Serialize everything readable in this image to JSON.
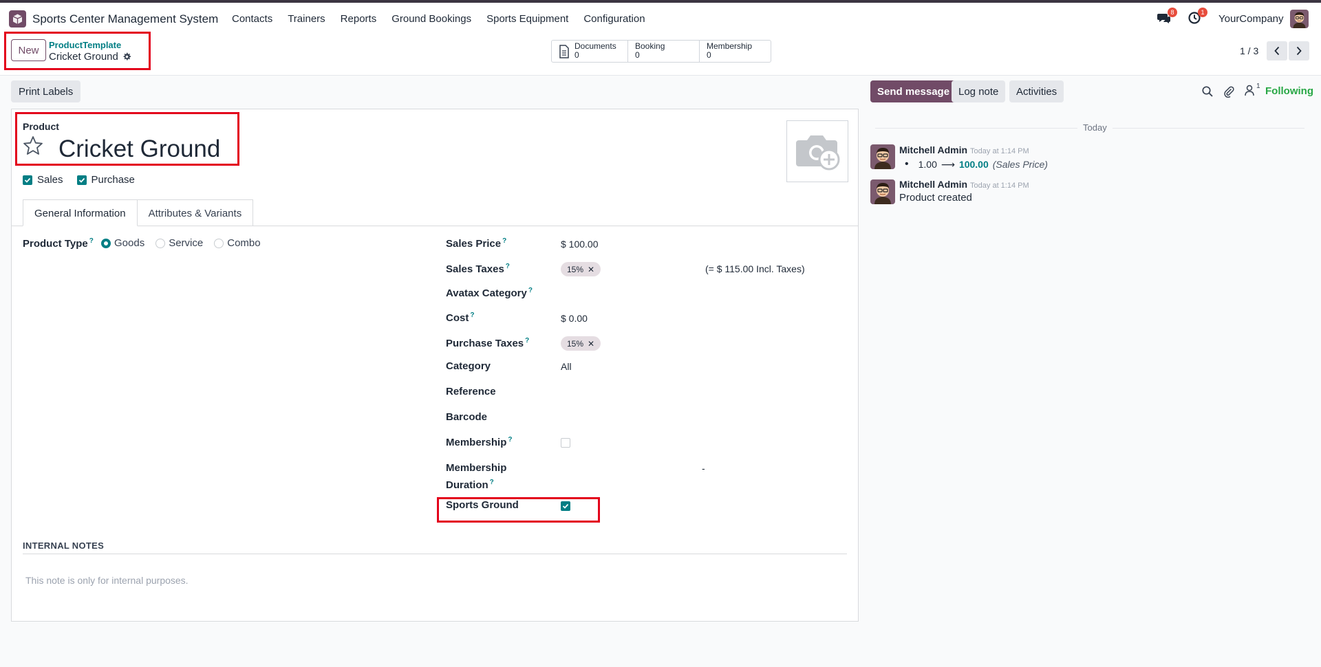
{
  "navbar": {
    "app_name": "Sports Center Management System",
    "menu": [
      "Contacts",
      "Trainers",
      "Reports",
      "Ground Bookings",
      "Sports Equipment",
      "Configuration"
    ],
    "messages_badge": "8",
    "activities_badge": "1",
    "company": "YourCompany"
  },
  "control": {
    "new_label": "New",
    "breadcrumb_parent": "ProductTemplate",
    "breadcrumb_current": "Cricket Ground",
    "smart_buttons": [
      {
        "label": "Documents",
        "count": "0"
      },
      {
        "label": "Booking",
        "count": "0"
      },
      {
        "label": "Membership",
        "count": "0"
      }
    ],
    "pager": "1 / 3"
  },
  "actions": {
    "print_labels": "Print Labels"
  },
  "form": {
    "product_label": "Product",
    "title": "Cricket Ground",
    "sales_label": "Sales",
    "purchase_label": "Purchase",
    "sales_checked": true,
    "purchase_checked": true,
    "tabs": [
      "General Information",
      "Attributes & Variants"
    ],
    "active_tab": "General Information",
    "product_type": {
      "label": "Product Type",
      "options": [
        "Goods",
        "Service",
        "Combo"
      ],
      "selected": "Goods"
    },
    "fields": {
      "sales_price_label": "Sales Price",
      "sales_price": "$ 100.00",
      "sales_taxes_label": "Sales Taxes",
      "sales_tax_tag": "15%",
      "sales_tax_incl": "(= $ 115.00 Incl. Taxes)",
      "avatax_label": "Avatax Category",
      "cost_label": "Cost",
      "cost": "$ 0.00",
      "purchase_taxes_label": "Purchase Taxes",
      "purchase_tax_tag": "15%",
      "category_label": "Category",
      "category": "All",
      "reference_label": "Reference",
      "barcode_label": "Barcode",
      "membership_label": "Membership",
      "membership_checked": false,
      "membership_duration_label_1": "Membership",
      "membership_duration_label_2": "Duration",
      "membership_duration": "-",
      "sports_ground_label": "Sports Ground",
      "sports_ground_checked": true
    },
    "internal_notes_heading": "INTERNAL NOTES",
    "internal_notes_placeholder": "This note is only for internal purposes."
  },
  "chatter": {
    "send_message": "Send message",
    "log_note": "Log note",
    "activities": "Activities",
    "followers_count": "1",
    "following": "Following",
    "today": "Today",
    "messages": [
      {
        "author": "Mitchell Admin",
        "time": "Today at 1:14 PM",
        "old": "1.00",
        "new": "100.00",
        "field": "(Sales Price)"
      },
      {
        "author": "Mitchell Admin",
        "time": "Today at 1:14 PM",
        "body": "Product created"
      }
    ]
  },
  "colors": {
    "brand": "#714b67",
    "teal": "#017e84",
    "highlight": "#e3001b",
    "following": "#28a745"
  }
}
